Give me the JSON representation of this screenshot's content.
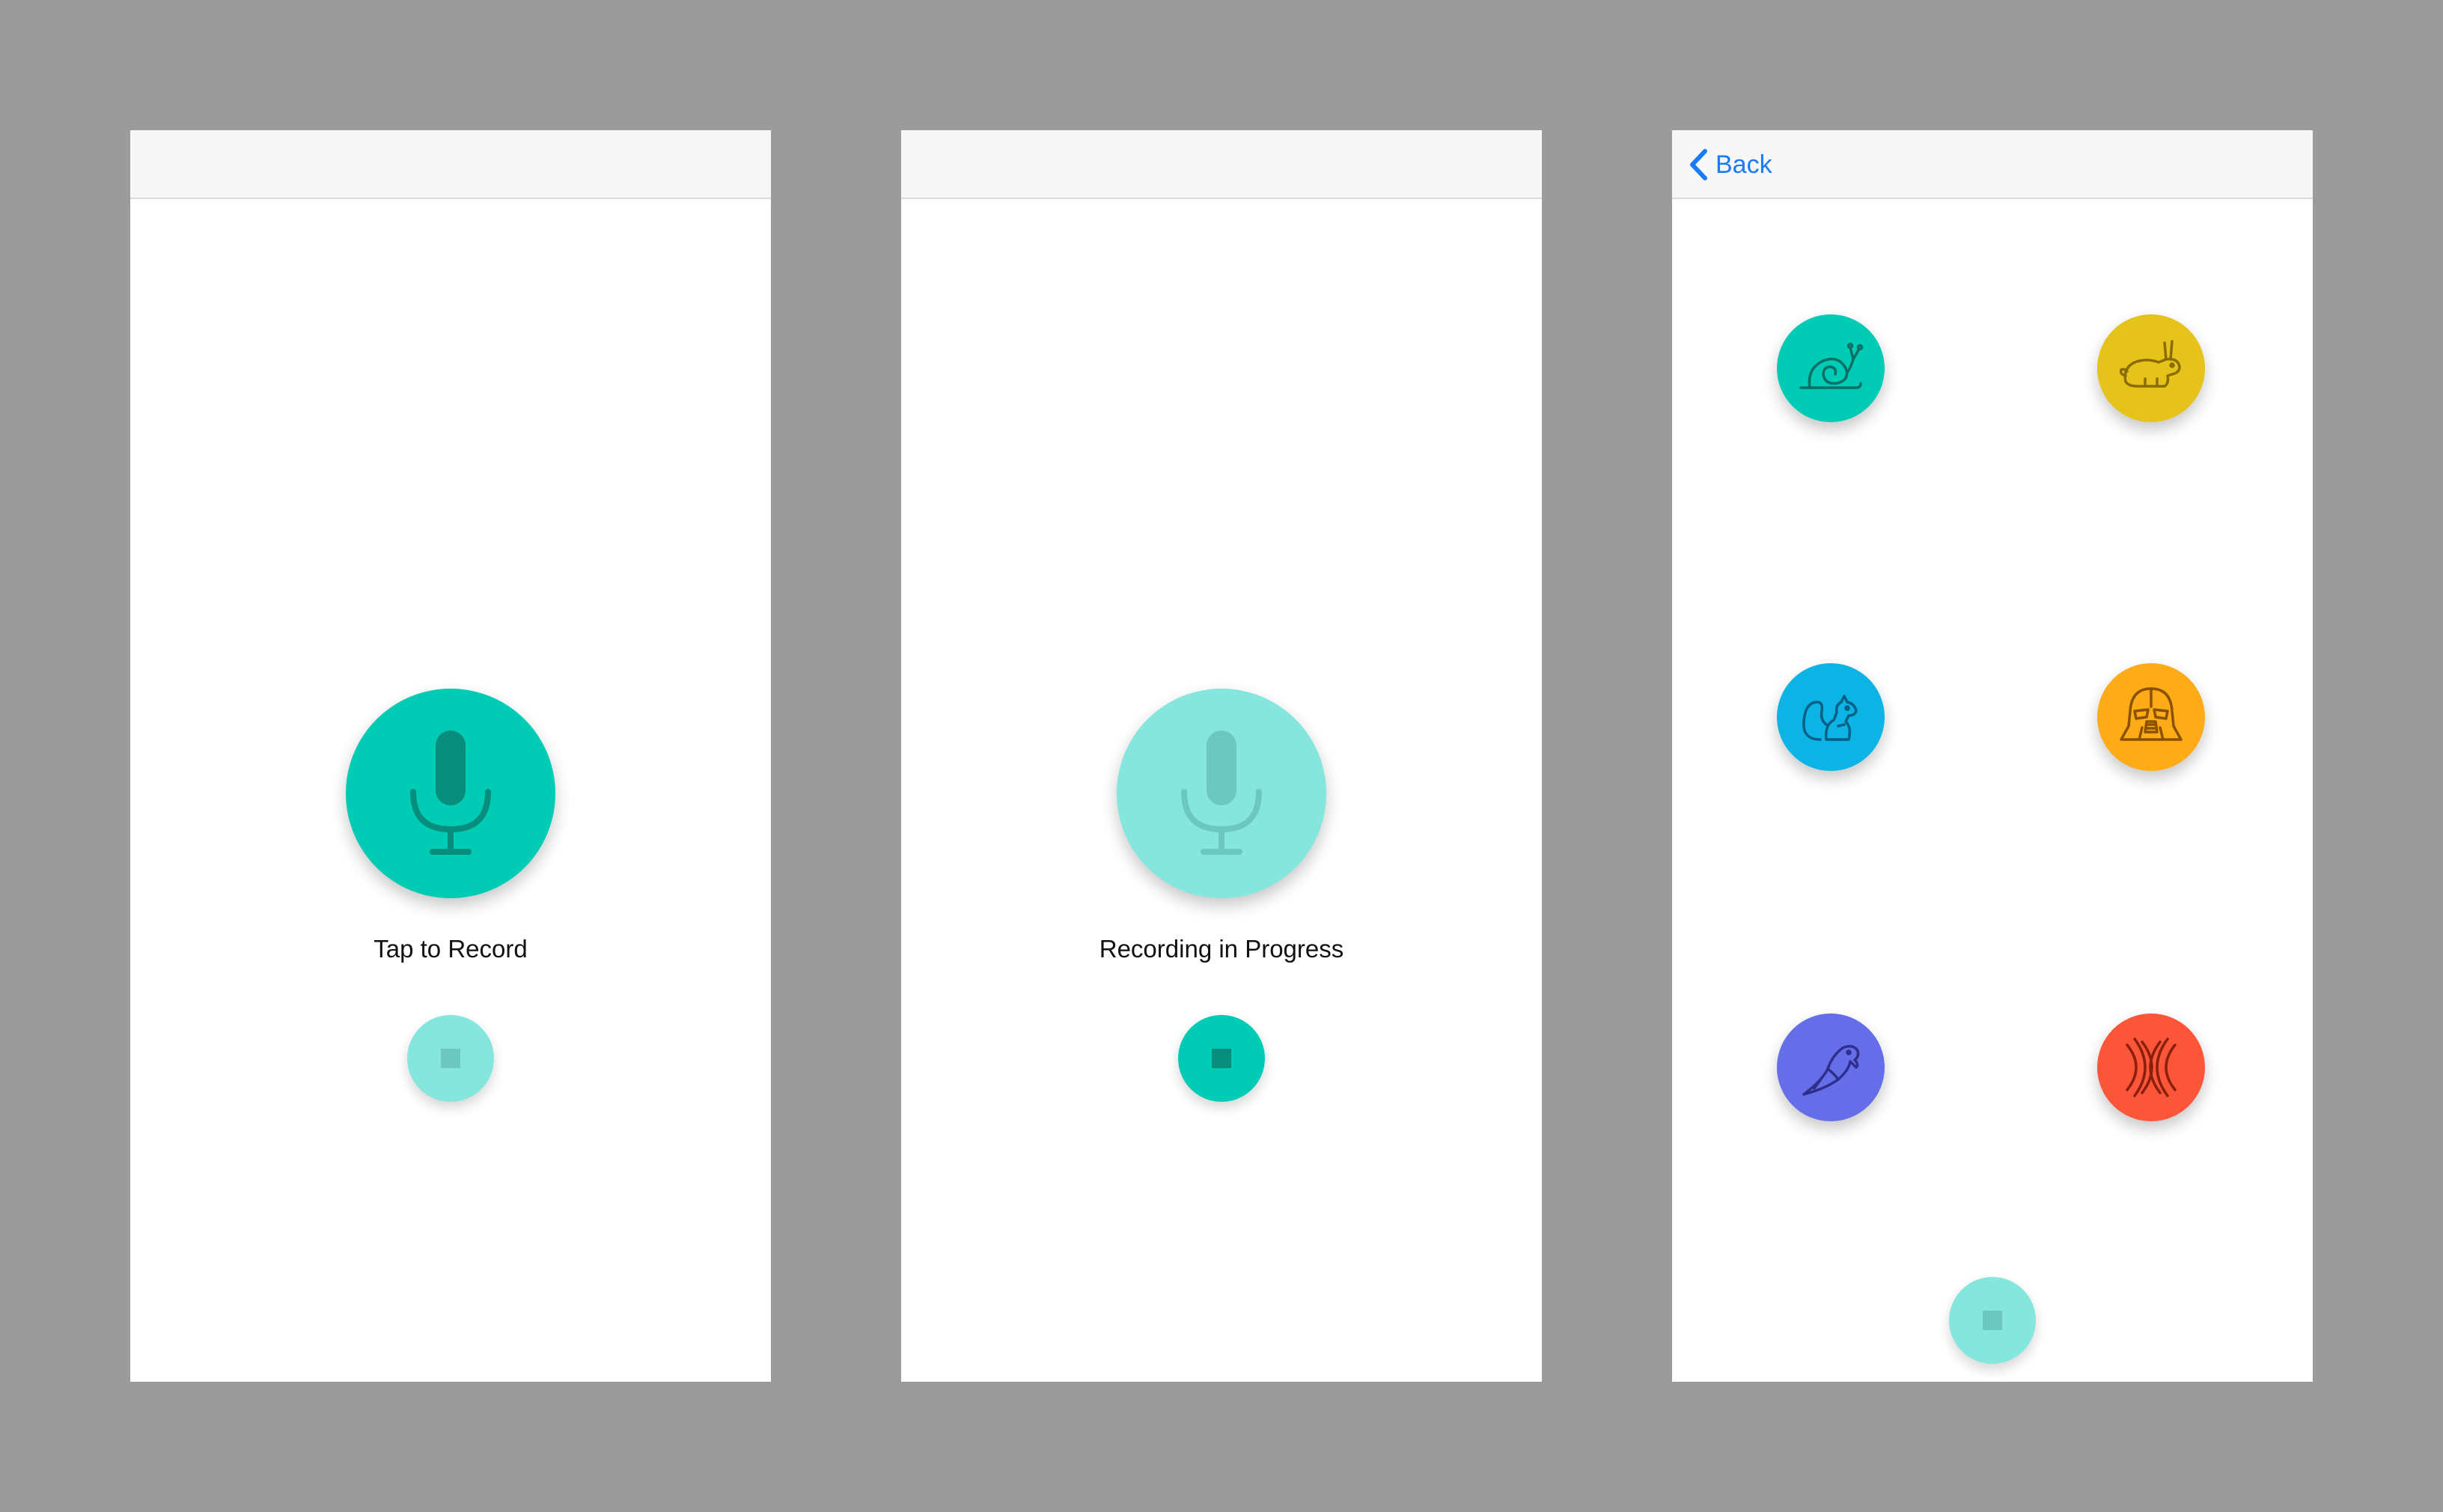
{
  "colors": {
    "background": "#9b9b9b",
    "screen": "#ffffff",
    "navbar": "#f7f7f7",
    "accent": "#00cbb4",
    "accent_light": "#85e6de",
    "icon_dark": "#078d7b",
    "icon_light": "#6cc8bf",
    "link": "#1a7cf5"
  },
  "screens": [
    {
      "status_label": "Tap to Record",
      "mic_state": "active",
      "stop_state": "disabled"
    },
    {
      "status_label": "Recording in Progress",
      "mic_state": "disabled",
      "stop_state": "active"
    },
    {
      "back_label": "Back",
      "back_icon": "chevron-left-icon",
      "effects": [
        {
          "name": "snail",
          "icon": "snail-icon",
          "color": "#00cbb4"
        },
        {
          "name": "rabbit",
          "icon": "rabbit-icon",
          "color": "#e6c31a"
        },
        {
          "name": "chipmunk",
          "icon": "squirrel-icon",
          "color": "#0cb4e6"
        },
        {
          "name": "darth-vader",
          "icon": "darth-vader-icon",
          "color": "#fdab16"
        },
        {
          "name": "parrot",
          "icon": "parrot-icon",
          "color": "#656de8"
        },
        {
          "name": "echo",
          "icon": "echo-icon",
          "color": "#fb553a"
        }
      ],
      "stop_state": "disabled"
    }
  ]
}
